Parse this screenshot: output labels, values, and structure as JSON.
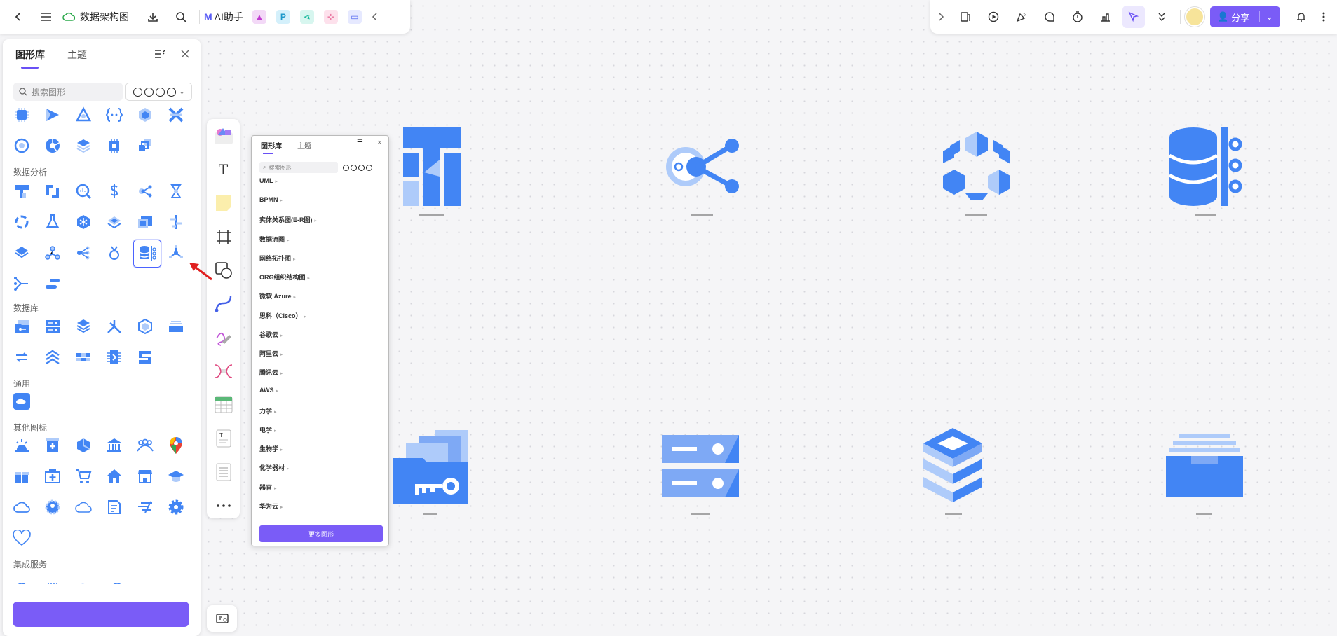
{
  "topbar": {
    "doc_title": "数据架构图",
    "ai_label": "AI助手",
    "share_label": "分享"
  },
  "sidebar": {
    "tabs": [
      "图形库",
      "主题"
    ],
    "search_placeholder": "搜索图形",
    "sections": {
      "data_analysis": "数据分析",
      "database": "数据库",
      "general": "通用",
      "other_icons": "其他图标",
      "integration": "集成服务"
    }
  },
  "popup": {
    "tabs": [
      "图形库",
      "主题"
    ],
    "search_placeholder": "搜索图形",
    "items": [
      "UML",
      "BPMN",
      "实体关系图(E-R图)",
      "数据流图",
      "网络拓扑图",
      "ORG组织结构图",
      "微软 Azure",
      "思科（Cisco）",
      "谷歌云",
      "阿里云",
      "腾讯云",
      "AWS",
      "力学",
      "电学",
      "生物学",
      "化学器材",
      "器官",
      "华为云"
    ],
    "more_button": "更多图形"
  },
  "colors": {
    "accent": "#7a5cf7",
    "icon_blue": "#4285f4",
    "icon_light": "#aecbfa"
  }
}
